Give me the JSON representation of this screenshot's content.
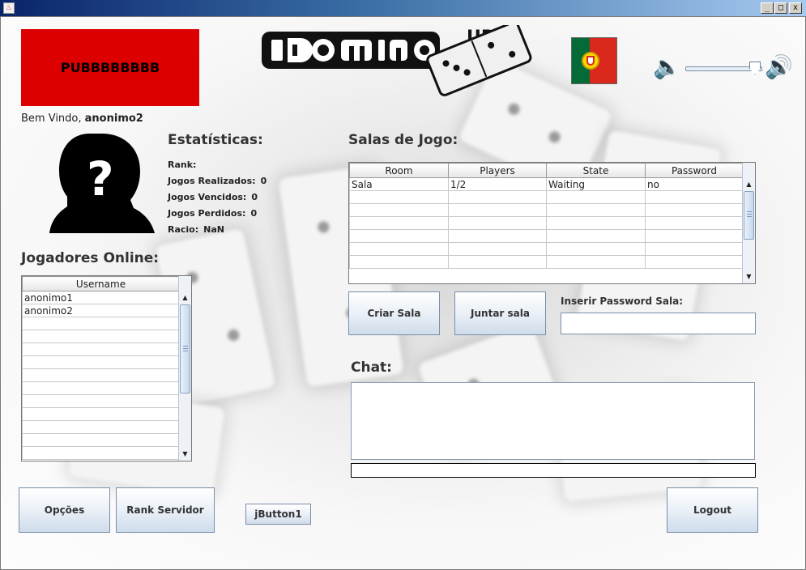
{
  "window": {
    "title": "",
    "minimize": "_",
    "maximize": "□",
    "close": "x"
  },
  "ad": {
    "text": "PUBBBBBBBB"
  },
  "welcome": {
    "prefix": "Bem Vindo,",
    "username": "anonimo2"
  },
  "stats": {
    "title": "Estatísticas:",
    "rank_label": "Rank:",
    "rank_value": "",
    "played_label": "Jogos Realizados:",
    "played_value": "0",
    "won_label": "Jogos Vencidos:",
    "won_value": "0",
    "lost_label": "Jogos Perdidos:",
    "lost_value": "0",
    "ratio_label": "Racio:",
    "ratio_value": "NaN"
  },
  "players": {
    "title": "Jogadores Online:",
    "header": "Username",
    "rows": [
      "anonimo1",
      "anonimo2",
      "",
      "",
      "",
      "",
      "",
      "",
      "",
      "",
      "",
      "",
      ""
    ]
  },
  "rooms": {
    "title": "Salas de Jogo:",
    "headers": [
      "Room",
      "Players",
      "State",
      "Password"
    ],
    "rows": [
      [
        "Sala",
        "1/2",
        "Waiting",
        "no"
      ],
      [
        "",
        "",
        "",
        ""
      ],
      [
        "",
        "",
        "",
        ""
      ],
      [
        "",
        "",
        "",
        ""
      ],
      [
        "",
        "",
        "",
        ""
      ],
      [
        "",
        "",
        "",
        ""
      ],
      [
        "",
        "",
        "",
        ""
      ]
    ]
  },
  "buttons": {
    "create_room": "Criar Sala",
    "join_room": "Juntar sala",
    "options": "Opções",
    "rank_server": "Rank Servidor",
    "jbutton1": "jButton1",
    "logout": "Logout"
  },
  "password": {
    "label": "Inserir Password Sala:",
    "value": ""
  },
  "chat": {
    "title": "Chat:",
    "messages": "",
    "input_value": ""
  },
  "colors": {
    "ad_background": "#dd0000",
    "flag_green": "#046a38",
    "flag_red": "#da291c"
  },
  "icons": {
    "app": "java-icon",
    "avatar": "unknown-user-icon",
    "flag": "portugal-flag-icon",
    "speaker_low": "speaker-low-icon",
    "speaker_high": "speaker-high-icon",
    "logo": "domino-up-logo"
  }
}
